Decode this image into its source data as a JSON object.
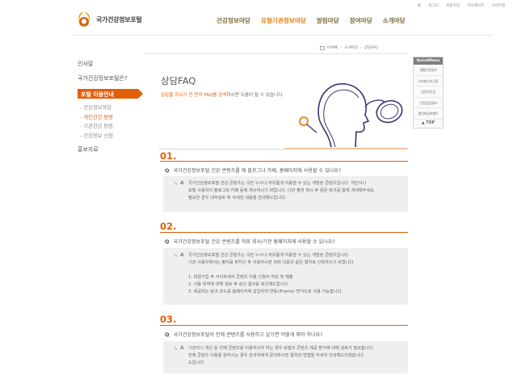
{
  "header": {
    "logo_text": "국가건강정보포털",
    "util_links": [
      "홈",
      "로그인",
      "회원가입",
      "마이페이지",
      "사이트맵"
    ],
    "gnb": [
      {
        "label": "건강정보마당",
        "active": false
      },
      {
        "label": "유형기관정보마당",
        "active": true
      },
      {
        "label": "알림마당",
        "active": false
      },
      {
        "label": "참여마당",
        "active": false
      },
      {
        "label": "소개마당",
        "active": false
      }
    ]
  },
  "breadcrumb": [
    "HOME",
    "소개마당",
    "상담FAQ"
  ],
  "lnb": {
    "items_top": [
      "인사말",
      "국가건강정보포털은?"
    ],
    "active": "포털 이용안내",
    "sub_items": [
      {
        "label": "건강정보마당",
        "on": false
      },
      {
        "label": "개인건강 탐방",
        "on": true
      },
      {
        "label": "기관건강 탐방",
        "on": false
      },
      {
        "label": "건강정보 신청",
        "on": false
      }
    ],
    "bottom": "홍보자료"
  },
  "quick_menu": {
    "title": "QuickMenu",
    "items": [
      "생활건강정보",
      "소아청소년건강",
      "임산부건강",
      "건강검진정보",
      "열린마당이벤트"
    ],
    "top": "▲ TOP"
  },
  "page": {
    "title": "상담FAQ",
    "intro_highlight": "질문을 하시기 전 먼저 FAQ를 검색",
    "intro_rest": "하시면 도움이 될 수 있습니다."
  },
  "faq": [
    {
      "num": "01.",
      "q_mark": "Q",
      "question": "국가건강정보포털 건강 콘텐츠를 제 블로그나 카페, 홈페이지에 사용할 수 있나요?",
      "a_mark": "A",
      "answer": [
        "국가건강정보포털 건강 콘텐츠는 국민 누구나 자유롭게 이용할 수 있는 개방된 콘텐츠입니다. 개인이나",
        "포털 사용자의 블로그와 카페 등에 게시하시기 바랍니다. 다만 출처 명시 후 원문 링크를 함께 게재해주세요.",
        "필요한 경우 내부검토 후 자세한 내용을 안내해드립니다."
      ]
    },
    {
      "num": "02.",
      "q_mark": "Q",
      "question": "국가건강정보포털 건강 콘텐츠를 저희 회사/기관 홈페이지에 사용할 수 있나요?",
      "a_mark": "A",
      "answer": [
        "국가건강정보포털 건강 콘텐츠는 국민 누구나 자유롭게 이용할 수 있는 개방된 콘텐츠입니다.",
        "기관 사용자께서는 출처를 밝히신 후 이용하시면 되며 다음과 같은 절차로 신청하시기 바랍니다.",
        "",
        "1. 회원가입 후 사이트에서 콘텐츠 이용 신청서 작성 및 제출",
        "2. 사용 목적에 대해 검토 후 승인 결과를 회신해드립니다.",
        "3. 제공되는 링크 코드를 홈페이지에 삽입하여 연동(iFrame) 방식으로 사용 가능합니다."
      ]
    },
    {
      "num": "03.",
      "q_mark": "Q",
      "question": "국가건강정보포털의 전체 콘텐츠를 사용하고 싶으면 어떻게 해야 하나요?",
      "a_mark": "A",
      "answer": [
        "기관이나 개인 등 전체 콘텐츠를 이용하고자 하는 경우 포털의 콘텐츠 제공 방식에 대해 검토가 필요합니다.",
        "전체 콘텐츠 이용을 원하시는 경우 관리자에게 문의하시면 절차와 방법을 자세히 안내해드리겠습니다.",
        "드립니다."
      ]
    }
  ]
}
